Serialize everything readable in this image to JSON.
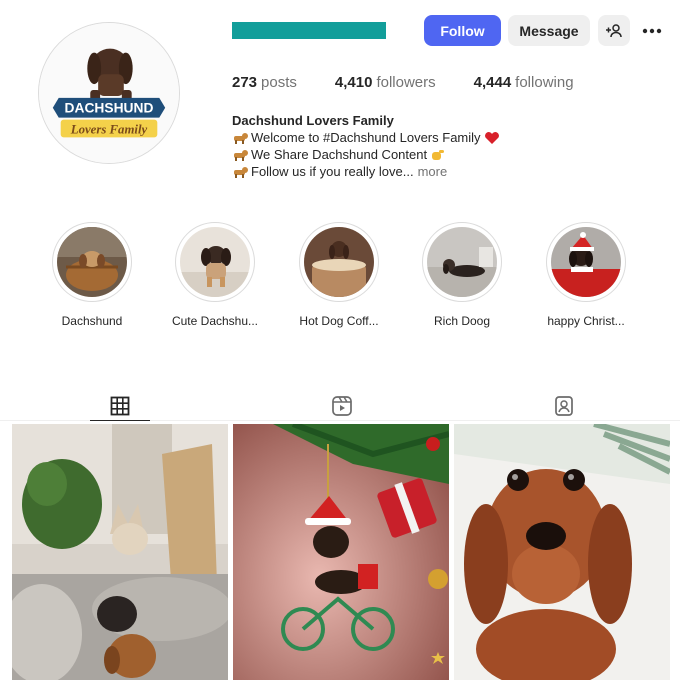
{
  "profile": {
    "avatar_icon": "dachshund-lovers-logo",
    "avatar_text_line1": "DACHSHUND",
    "avatar_text_line2": "Lovers Family",
    "username_redacted_color": "#129e9a"
  },
  "actions": {
    "follow_label": "Follow",
    "message_label": "Message",
    "add_user_icon": "add-user-icon",
    "more_icon": "more-options-icon"
  },
  "stats": {
    "posts_count": "273",
    "posts_label": "posts",
    "followers_count": "4,410",
    "followers_label": "followers",
    "following_count": "4,444",
    "following_label": "following"
  },
  "bio": {
    "name": "Dachshund Lovers Family",
    "line1": "Welcome to #Dachshund Lovers Family",
    "line2": "We Share Dachshund Content",
    "line3": "Follow us if you really love...",
    "more": "more"
  },
  "highlights": [
    {
      "label": "Dachshund"
    },
    {
      "label": "Cute Dachshu..."
    },
    {
      "label": "Hot Dog Coff..."
    },
    {
      "label": "Rich Doog"
    },
    {
      "label": "happy Christ..."
    }
  ],
  "tabs": [
    {
      "name": "posts",
      "icon": "grid-icon",
      "active": true
    },
    {
      "name": "reels",
      "icon": "reels-icon",
      "active": false
    },
    {
      "name": "tagged",
      "icon": "tagged-icon",
      "active": false
    }
  ],
  "colors": {
    "accent": "#4f66f2",
    "secondary_button": "#efefef",
    "text": "#262626",
    "muted": "#737373"
  }
}
